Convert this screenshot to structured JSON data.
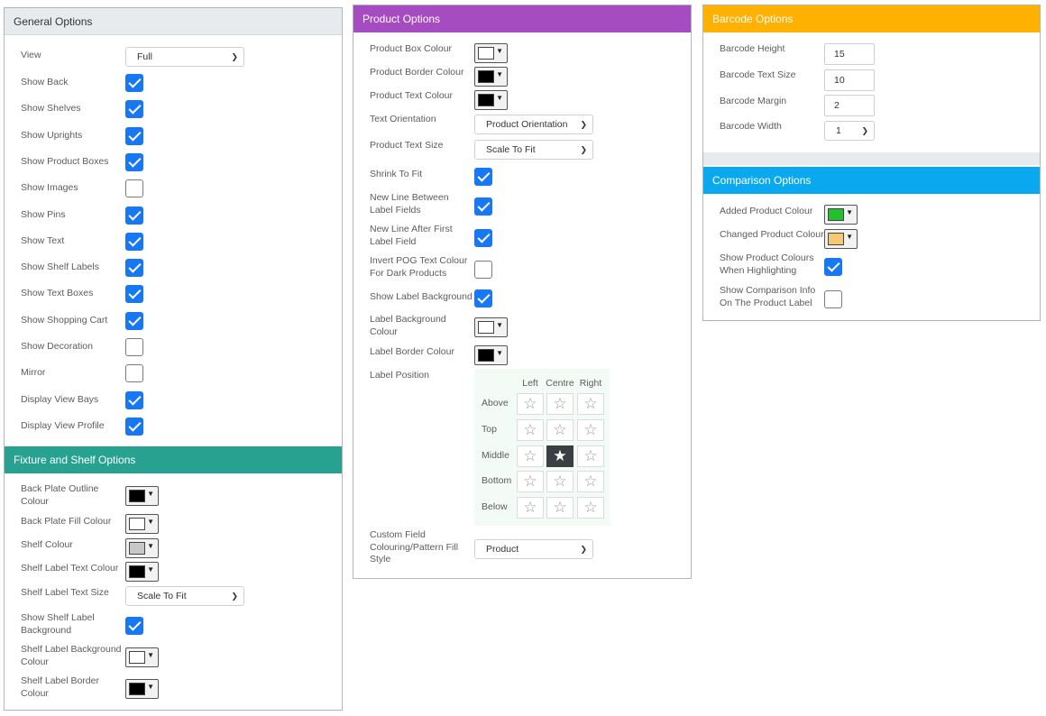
{
  "general": {
    "title": "General Options",
    "view_label": "View",
    "view_value": "Full",
    "items": [
      {
        "label": "Show Back",
        "checked": true
      },
      {
        "label": "Show Shelves",
        "checked": true
      },
      {
        "label": "Show Uprights",
        "checked": true
      },
      {
        "label": "Show Product Boxes",
        "checked": true
      },
      {
        "label": "Show Images",
        "checked": false
      },
      {
        "label": "Show Pins",
        "checked": true
      },
      {
        "label": "Show Text",
        "checked": true
      },
      {
        "label": "Show Shelf Labels",
        "checked": true
      },
      {
        "label": "Show Text Boxes",
        "checked": true
      },
      {
        "label": "Show Shopping Cart",
        "checked": true
      },
      {
        "label": "Show Decoration",
        "checked": false
      },
      {
        "label": "Mirror",
        "checked": false
      },
      {
        "label": "Display View Bays",
        "checked": true
      },
      {
        "label": "Display View Profile",
        "checked": true
      }
    ]
  },
  "fixture": {
    "title": "Fixture and Shelf Options",
    "back_plate_outline": {
      "label": "Back Plate Outline Colour",
      "color": "#000000"
    },
    "back_plate_fill": {
      "label": "Back Plate Fill Colour",
      "color": "#ffffff"
    },
    "shelf_colour": {
      "label": "Shelf Colour",
      "color": "#c8c8c8"
    },
    "shelf_label_text_colour": {
      "label": "Shelf Label Text Colour",
      "color": "#000000"
    },
    "shelf_label_text_size": {
      "label": "Shelf Label Text Size",
      "value": "Scale To Fit"
    },
    "show_shelf_label_bg": {
      "label": "Show Shelf Label Background",
      "checked": true
    },
    "shelf_label_bg_colour": {
      "label": "Shelf Label Background Colour",
      "color": "#ffffff"
    },
    "shelf_label_border_colour": {
      "label": "Shelf Label Border Colour",
      "color": "#000000"
    }
  },
  "product": {
    "title": "Product Options",
    "box_colour": {
      "label": "Product Box Colour",
      "color": "#ffffff"
    },
    "border_colour": {
      "label": "Product Border Colour",
      "color": "#000000"
    },
    "text_colour": {
      "label": "Product Text Colour",
      "color": "#000000"
    },
    "text_orientation": {
      "label": "Text Orientation",
      "value": "Product Orientation"
    },
    "text_size": {
      "label": "Product Text Size",
      "value": "Scale To Fit"
    },
    "shrink_to_fit": {
      "label": "Shrink To Fit",
      "checked": true
    },
    "new_line_between": {
      "label": "New Line Between Label Fields",
      "checked": true
    },
    "new_line_after": {
      "label": "New Line After First Label Field",
      "checked": true
    },
    "invert_pog": {
      "label": "Invert POG Text Colour For Dark Products",
      "checked": false
    },
    "show_label_bg": {
      "label": "Show Label Background",
      "checked": true
    },
    "label_bg_colour": {
      "label": "Label Background Colour",
      "color": "#ffffff"
    },
    "label_border_colour": {
      "label": "Label Border Colour",
      "color": "#000000"
    },
    "label_position": {
      "label": "Label Position",
      "columns": [
        "Left",
        "Centre",
        "Right"
      ],
      "rows": [
        "Above",
        "Top",
        "Middle",
        "Bottom",
        "Below"
      ],
      "selected_row": "Middle",
      "selected_column": "Centre"
    },
    "custom_field": {
      "label": "Custom Field Colouring/Pattern Fill Style",
      "value": "Product"
    }
  },
  "barcode": {
    "title": "Barcode Options",
    "height": {
      "label": "Barcode Height",
      "value": "15"
    },
    "text_size": {
      "label": "Barcode Text Size",
      "value": "10"
    },
    "margin": {
      "label": "Barcode Margin",
      "value": "2"
    },
    "width": {
      "label": "Barcode Width",
      "value": "1"
    }
  },
  "comparison": {
    "title": "Comparison Options",
    "added_colour": {
      "label": "Added Product Colour",
      "color": "#22c02f"
    },
    "changed_colour": {
      "label": "Changed Product Colour",
      "color": "#f6c873"
    },
    "show_colours": {
      "label": "Show Product Colours When Highlighting",
      "checked": true
    },
    "show_info": {
      "label": "Show Comparison Info On The Product Label",
      "checked": false
    }
  },
  "icons": {
    "star_empty": "☆",
    "star_filled": "★",
    "swatch_arrow": "▼",
    "select_chevron": "chevron-down"
  }
}
